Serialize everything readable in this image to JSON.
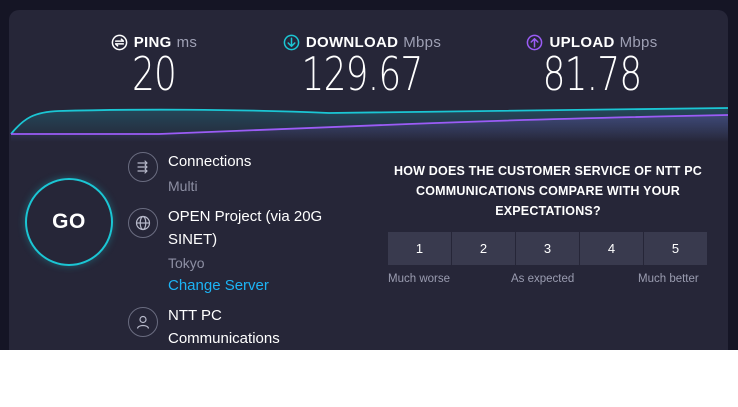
{
  "metrics": {
    "ping": {
      "label": "PING",
      "unit": "ms",
      "value": "20"
    },
    "download": {
      "label": "DOWNLOAD",
      "unit": "Mbps",
      "value": "129.67"
    },
    "upload": {
      "label": "UPLOAD",
      "unit": "Mbps",
      "value": "81.78"
    }
  },
  "colors": {
    "download_accent": "#1bc6d4",
    "upload_accent": "#9b5cf6",
    "link": "#1cb4f5",
    "panel_bg": "#262638",
    "outer_bg": "#151525"
  },
  "go_button": {
    "label": "GO"
  },
  "connections": {
    "title": "Connections",
    "value": "Multi",
    "icon": "connections-arrows-icon"
  },
  "server": {
    "name": "OPEN Project (via 20G SINET)",
    "location": "Tokyo",
    "change_label": "Change Server",
    "icon": "globe-icon"
  },
  "provider": {
    "name": "NTT PC Communications",
    "icon": "user-icon"
  },
  "survey": {
    "question": "HOW DOES THE CUSTOMER SERVICE OF NTT PC COMMUNICATIONS COMPARE WITH YOUR EXPECTATIONS?",
    "ratings": [
      "1",
      "2",
      "3",
      "4",
      "5"
    ],
    "scale_low": "Much worse",
    "scale_mid": "As expected",
    "scale_high": "Much better"
  }
}
